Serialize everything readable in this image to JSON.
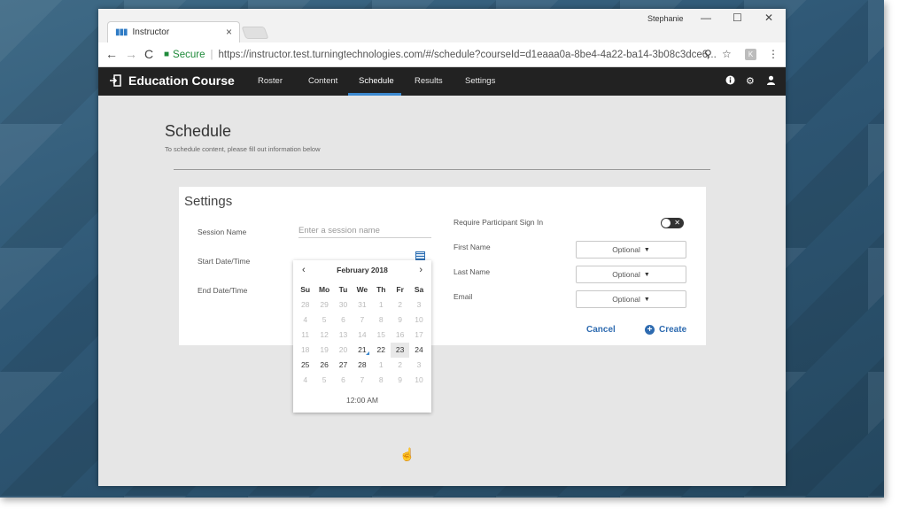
{
  "browser": {
    "tab_title": "Instructor",
    "tab_close": "×",
    "profile_name": "Stephanie",
    "window_controls": {
      "minimize": "—",
      "maximize": "☐",
      "close": "✕"
    },
    "nav": {
      "back": "←",
      "forward": "→",
      "reload": "C"
    },
    "security_label": "Secure",
    "url": "https://instructor.test.turningtechnologies.com/#/schedule?courseId=d1eaaa0a-8be4-4a22-ba14-3b08c3dce6...",
    "extension_label": "K"
  },
  "app": {
    "course_title": "Education Course",
    "nav_items": [
      {
        "label": "Roster"
      },
      {
        "label": "Content"
      },
      {
        "label": "Schedule"
      },
      {
        "label": "Results"
      },
      {
        "label": "Settings"
      }
    ],
    "active_nav": "Schedule",
    "icons": [
      "help-icon",
      "gear-icon",
      "user-icon"
    ]
  },
  "page": {
    "title": "Schedule",
    "subtitle": "To schedule content, please fill out information below"
  },
  "settings": {
    "title": "Settings",
    "session_name_label": "Session Name",
    "session_name_placeholder": "Enter a session name",
    "start_label": "Start Date/Time",
    "end_label": "End Date/Time",
    "require_signin_label": "Require Participant Sign In",
    "toggle_mark": "✕",
    "first_name_label": "First Name",
    "first_name_value": "Optional",
    "last_name_label": "Last Name",
    "last_name_value": "Optional",
    "email_label": "Email",
    "email_value": "Optional",
    "cancel_label": "Cancel",
    "create_label": "Create"
  },
  "datepicker": {
    "month_label": "February 2018",
    "prev": "‹",
    "next": "›",
    "days_of_week": [
      "Su",
      "Mo",
      "Tu",
      "We",
      "Th",
      "Fr",
      "Sa"
    ],
    "weeks": [
      [
        "28",
        "29",
        "30",
        "31",
        "1",
        "2",
        "3"
      ],
      [
        "4",
        "5",
        "6",
        "7",
        "8",
        "9",
        "10"
      ],
      [
        "11",
        "12",
        "13",
        "14",
        "15",
        "16",
        "17"
      ],
      [
        "18",
        "19",
        "20",
        "21",
        "22",
        "23",
        "24"
      ],
      [
        "25",
        "26",
        "27",
        "28",
        "1",
        "2",
        "3"
      ],
      [
        "4",
        "5",
        "6",
        "7",
        "8",
        "9",
        "10"
      ]
    ],
    "time": "12:00 AM"
  },
  "colors": {
    "accent": "#3c89d0",
    "nav_bg": "#222222",
    "link": "#2e6bb0",
    "secure": "#1f8a3a"
  }
}
